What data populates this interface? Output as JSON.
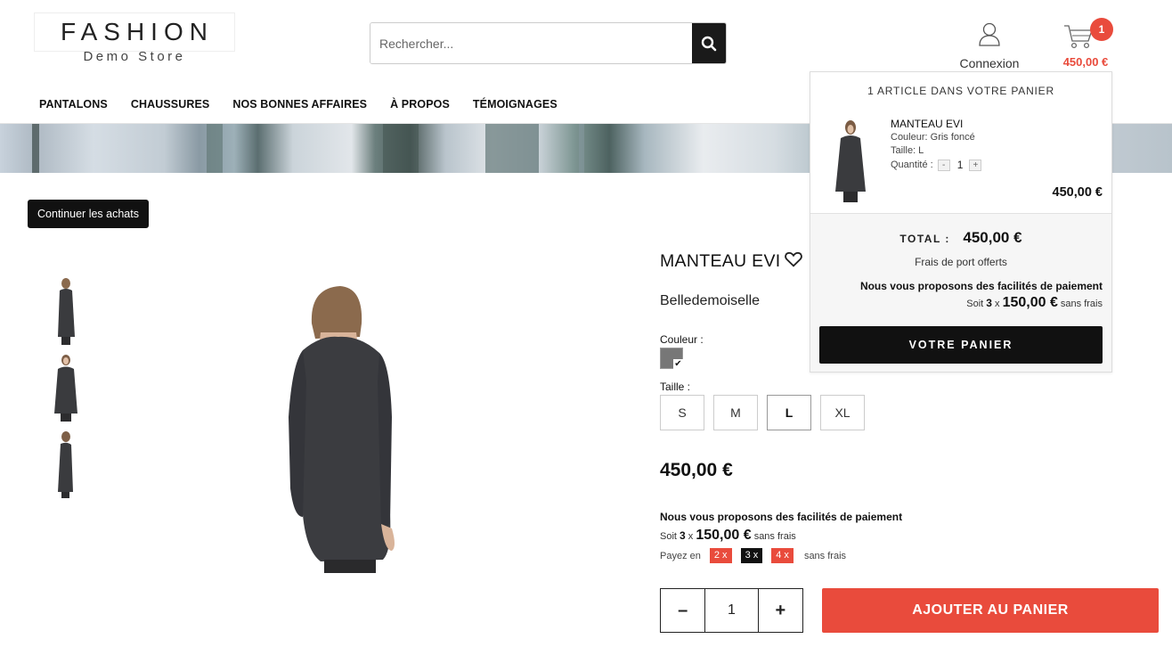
{
  "logo": {
    "line1": "FASHION",
    "line2": "Demo Store"
  },
  "search": {
    "placeholder": "Rechercher..."
  },
  "header": {
    "login_label": "Connexion",
    "cart_count": "1",
    "cart_total": "450,00 €"
  },
  "nav": {
    "items": [
      {
        "label": "PANTALONS"
      },
      {
        "label": "CHAUSSURES"
      },
      {
        "label": "NOS BONNES AFFAIRES"
      },
      {
        "label": "À PROPOS"
      },
      {
        "label": "TÉMOIGNAGES"
      }
    ]
  },
  "continue_label": "Continuer les achats",
  "product": {
    "title": "MANTEAU EVI",
    "brand": "Belledemoiselle",
    "color_label": "Couleur :",
    "color_swatch": "#777777",
    "size_label": "Taille :",
    "sizes": [
      "S",
      "M",
      "L",
      "XL"
    ],
    "selected_size": "L",
    "price": "450,00 €",
    "payment": {
      "heading": "Nous vous proposons des facilités de paiement",
      "soit": "Soit",
      "times": "3",
      "x": "x",
      "installment": "150,00 €",
      "no_fees": "sans frais",
      "payez_en": "Payez en",
      "options": [
        "2 x",
        "3 x",
        "4 x"
      ],
      "options_no_fees": "sans frais"
    },
    "quantity": "1",
    "minus": "–",
    "plus": "+",
    "add_to_cart": "AJOUTER AU PANIER"
  },
  "cart_dropdown": {
    "heading": "1 ARTICLE DANS VOTRE PANIER",
    "item": {
      "name": "MANTEAU EVI",
      "color": "Couleur: Gris foncé",
      "size": "Taille: L",
      "qty_label": "Quantité :",
      "qty": "1",
      "minus": "-",
      "plus": "+",
      "price": "450,00 €"
    },
    "total_label": "TOTAL :",
    "total_value": "450,00 €",
    "shipping": "Frais de port offerts",
    "payment_heading": "Nous vous proposons des facilités de paiement",
    "soit": "Soit",
    "times": "3",
    "x": "x",
    "installment": "150,00 €",
    "no_fees": "sans frais",
    "button": "VOTRE PANIER"
  },
  "colors": {
    "accent": "#e94b3c",
    "dark": "#111111"
  }
}
